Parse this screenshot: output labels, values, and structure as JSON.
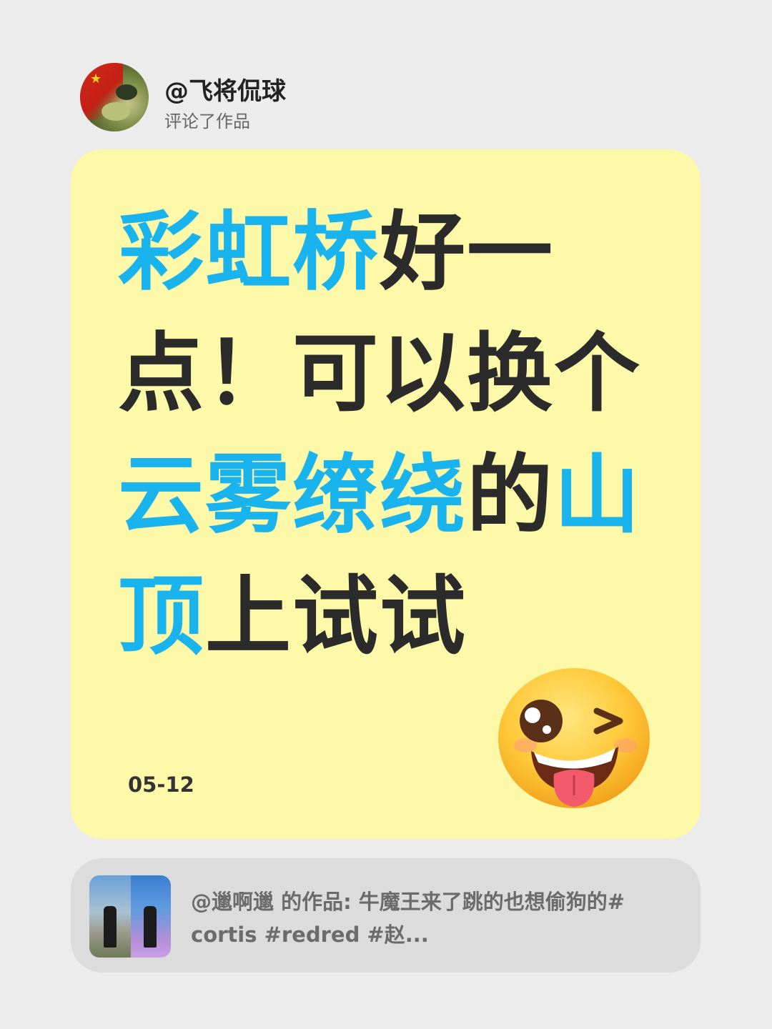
{
  "header": {
    "username": "@飞将侃球",
    "subtitle": "评论了作品"
  },
  "card": {
    "comment_segments": [
      {
        "text": "彩虹桥",
        "highlight": true
      },
      {
        "text": "好一点！可以换个",
        "highlight": false
      },
      {
        "text": "云雾缭绕",
        "highlight": true
      },
      {
        "text": "的",
        "highlight": false
      },
      {
        "text": "山顶",
        "highlight": true
      },
      {
        "text": "上试试",
        "highlight": false
      }
    ],
    "date": "05-12",
    "emoji": "winking-face-with-tongue-icon"
  },
  "reference": {
    "text": "@邋啊邋 的作品: 牛魔王来了跳的也想偷狗的# cortis #redred #赵..."
  },
  "colors": {
    "background": "#ececec",
    "card": "#fdf9a9",
    "highlight": "#19b3ee",
    "text": "#2b2b2b",
    "reference_bar": "#dcdcdc"
  }
}
